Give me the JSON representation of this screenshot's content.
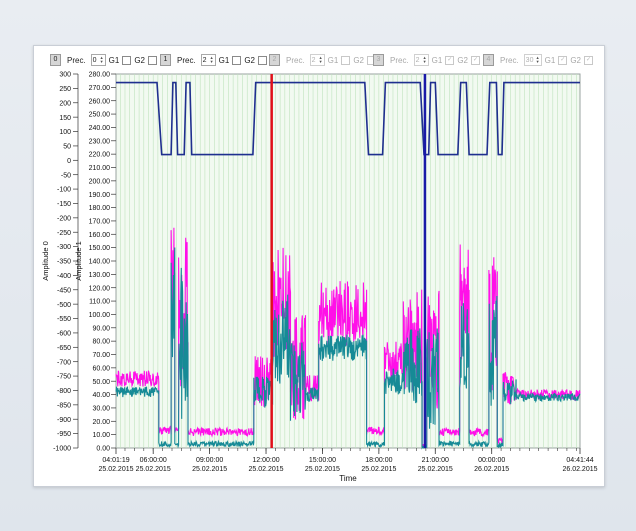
{
  "toolbar": {
    "prec_label": "Prec.",
    "g1_label": "G1",
    "g2_label": "G2",
    "axes": [
      {
        "index": "0",
        "prec": "0",
        "g1": false,
        "g2": false,
        "enabled": true
      },
      {
        "index": "1",
        "prec": "2",
        "g1": false,
        "g2": false,
        "enabled": true
      },
      {
        "index": "2",
        "prec": "2",
        "g1": false,
        "g2": false,
        "enabled": false
      },
      {
        "index": "3",
        "prec": "2",
        "g1": true,
        "g2": true,
        "enabled": false
      },
      {
        "index": "4",
        "prec": "30",
        "g1": true,
        "g2": true,
        "enabled": false
      }
    ]
  },
  "chart_data": {
    "type": "line",
    "xlabel": "Time",
    "ylabel_left": "Amplitude 0",
    "ylabel_right": "Amplitude 1",
    "y0_ticks": [
      "300",
      "250",
      "200",
      "150",
      "100",
      "50",
      "0",
      "-50",
      "-100",
      "-150",
      "-200",
      "-250",
      "-300",
      "-350",
      "-400",
      "-450",
      "-500",
      "-550",
      "-600",
      "-650",
      "-700",
      "-750",
      "-800",
      "-850",
      "-900",
      "-950",
      "-1000"
    ],
    "y1_ticks": [
      "280.00",
      "270.00",
      "260.00",
      "250.00",
      "240.00",
      "230.00",
      "220.00",
      "210.00",
      "200.00",
      "190.00",
      "180.00",
      "170.00",
      "160.00",
      "150.00",
      "140.00",
      "130.00",
      "120.00",
      "110.00",
      "100.00",
      "90.00",
      "80.00",
      "70.00",
      "60.00",
      "50.00",
      "40.00",
      "30.00",
      "20.00",
      "10.00",
      "0.00"
    ],
    "y0_range": [
      -1000,
      300
    ],
    "y1_range": [
      0,
      280
    ],
    "x_ticks": [
      {
        "time": "04:01:19",
        "date": "25.02.2015"
      },
      {
        "time": "06:00:00",
        "date": "25.02.2015"
      },
      {
        "time": "09:00:00",
        "date": "25.02.2015"
      },
      {
        "time": "12:00:00",
        "date": "25.02.2015"
      },
      {
        "time": "15:00:00",
        "date": "25.02.2015"
      },
      {
        "time": "18:00:00",
        "date": "25.02.2015"
      },
      {
        "time": "21:00:00",
        "date": "25.02.2015"
      },
      {
        "time": "00:00:00",
        "date": "26.02.2015"
      },
      {
        "time": "04:41:44",
        "date": "26.02.2015"
      }
    ],
    "x_range_hours": [
      4.022,
      28.696
    ],
    "grid": true,
    "cursors": [
      {
        "name": "cursor-red",
        "hour": 12.3,
        "color": "#e0101a"
      },
      {
        "name": "cursor-blue",
        "hour": 20.45,
        "color": "#1a1aa8"
      }
    ],
    "series": [
      {
        "color": "#1f2f8f",
        "axis": "y0",
        "points": [
          [
            4.022,
            270
          ],
          [
            6.2,
            270
          ],
          [
            6.45,
            20
          ],
          [
            6.95,
            20
          ],
          [
            7.05,
            270
          ],
          [
            7.2,
            270
          ],
          [
            7.3,
            20
          ],
          [
            7.65,
            20
          ],
          [
            7.75,
            270
          ],
          [
            7.95,
            270
          ],
          [
            8.05,
            20
          ],
          [
            11.3,
            20
          ],
          [
            11.45,
            270
          ],
          [
            17.25,
            270
          ],
          [
            17.45,
            20
          ],
          [
            18.2,
            20
          ],
          [
            18.35,
            270
          ],
          [
            20.2,
            270
          ],
          [
            20.4,
            20
          ],
          [
            20.65,
            20
          ],
          [
            20.75,
            270
          ],
          [
            21.0,
            270
          ],
          [
            21.15,
            20
          ],
          [
            22.2,
            20
          ],
          [
            22.35,
            270
          ],
          [
            22.65,
            270
          ],
          [
            22.8,
            20
          ],
          [
            23.75,
            20
          ],
          [
            23.9,
            270
          ],
          [
            24.25,
            270
          ],
          [
            24.35,
            20
          ],
          [
            24.55,
            20
          ],
          [
            24.65,
            270
          ],
          [
            28.696,
            270
          ]
        ]
      },
      {
        "color": "#ff10e8",
        "axis": "y1",
        "segments": [
          {
            "start": 4.022,
            "end": 6.3,
            "level": 52,
            "amp": 6
          },
          {
            "start": 6.3,
            "end": 6.95,
            "level": 13,
            "amp": 3
          },
          {
            "start": 6.95,
            "end": 7.15,
            "level": 120,
            "amp": 50
          },
          {
            "start": 7.15,
            "end": 7.35,
            "level": 13,
            "amp": 3
          },
          {
            "start": 7.35,
            "end": 7.85,
            "level": 100,
            "amp": 60
          },
          {
            "start": 7.85,
            "end": 11.35,
            "level": 12,
            "amp": 3
          },
          {
            "start": 11.35,
            "end": 12.35,
            "level": 50,
            "amp": 20
          },
          {
            "start": 12.35,
            "end": 13.3,
            "level": 110,
            "amp": 45
          },
          {
            "start": 13.3,
            "end": 14.1,
            "level": 60,
            "amp": 40
          },
          {
            "start": 14.1,
            "end": 14.8,
            "level": 45,
            "amp": 10
          },
          {
            "start": 14.8,
            "end": 17.35,
            "level": 100,
            "amp": 25
          },
          {
            "start": 17.35,
            "end": 18.3,
            "level": 13,
            "amp": 3
          },
          {
            "start": 18.3,
            "end": 19.3,
            "level": 65,
            "amp": 15
          },
          {
            "start": 19.3,
            "end": 20.3,
            "level": 80,
            "amp": 40
          },
          {
            "start": 20.3,
            "end": 20.55,
            "level": 2,
            "amp": 2
          },
          {
            "start": 20.55,
            "end": 21.2,
            "level": 70,
            "amp": 50
          },
          {
            "start": 21.2,
            "end": 22.3,
            "level": 12,
            "amp": 3
          },
          {
            "start": 22.3,
            "end": 22.8,
            "level": 110,
            "amp": 45
          },
          {
            "start": 22.8,
            "end": 23.85,
            "level": 12,
            "amp": 3
          },
          {
            "start": 23.85,
            "end": 24.3,
            "level": 90,
            "amp": 55
          },
          {
            "start": 24.3,
            "end": 24.6,
            "level": 5,
            "amp": 3
          },
          {
            "start": 24.6,
            "end": 25.3,
            "level": 45,
            "amp": 12
          },
          {
            "start": 25.3,
            "end": 28.696,
            "level": 40,
            "amp": 4
          }
        ]
      },
      {
        "color": "#168a96",
        "axis": "y1",
        "segments": [
          {
            "start": 4.022,
            "end": 6.3,
            "level": 42,
            "amp": 4
          },
          {
            "start": 6.3,
            "end": 6.95,
            "level": 3,
            "amp": 2
          },
          {
            "start": 6.95,
            "end": 7.15,
            "level": 100,
            "amp": 60
          },
          {
            "start": 7.15,
            "end": 7.35,
            "level": 3,
            "amp": 2
          },
          {
            "start": 7.35,
            "end": 7.85,
            "level": 80,
            "amp": 60
          },
          {
            "start": 7.85,
            "end": 11.35,
            "level": 3,
            "amp": 2
          },
          {
            "start": 11.35,
            "end": 12.35,
            "level": 42,
            "amp": 12
          },
          {
            "start": 12.35,
            "end": 13.3,
            "level": 80,
            "amp": 35
          },
          {
            "start": 13.3,
            "end": 14.1,
            "level": 50,
            "amp": 30
          },
          {
            "start": 14.1,
            "end": 14.8,
            "level": 40,
            "amp": 6
          },
          {
            "start": 14.8,
            "end": 17.35,
            "level": 75,
            "amp": 10
          },
          {
            "start": 17.35,
            "end": 18.3,
            "level": 3,
            "amp": 2
          },
          {
            "start": 18.3,
            "end": 19.3,
            "level": 50,
            "amp": 10
          },
          {
            "start": 19.3,
            "end": 20.3,
            "level": 60,
            "amp": 30
          },
          {
            "start": 20.3,
            "end": 20.55,
            "level": 1,
            "amp": 1
          },
          {
            "start": 20.55,
            "end": 21.2,
            "level": 50,
            "amp": 40
          },
          {
            "start": 21.2,
            "end": 22.3,
            "level": 3,
            "amp": 2
          },
          {
            "start": 22.3,
            "end": 22.8,
            "level": 80,
            "amp": 40
          },
          {
            "start": 22.8,
            "end": 23.85,
            "level": 3,
            "amp": 2
          },
          {
            "start": 23.85,
            "end": 24.3,
            "level": 70,
            "amp": 45
          },
          {
            "start": 24.3,
            "end": 24.6,
            "level": 2,
            "amp": 2
          },
          {
            "start": 24.6,
            "end": 25.3,
            "level": 42,
            "amp": 10
          },
          {
            "start": 25.3,
            "end": 28.696,
            "level": 38,
            "amp": 3
          }
        ]
      }
    ]
  }
}
